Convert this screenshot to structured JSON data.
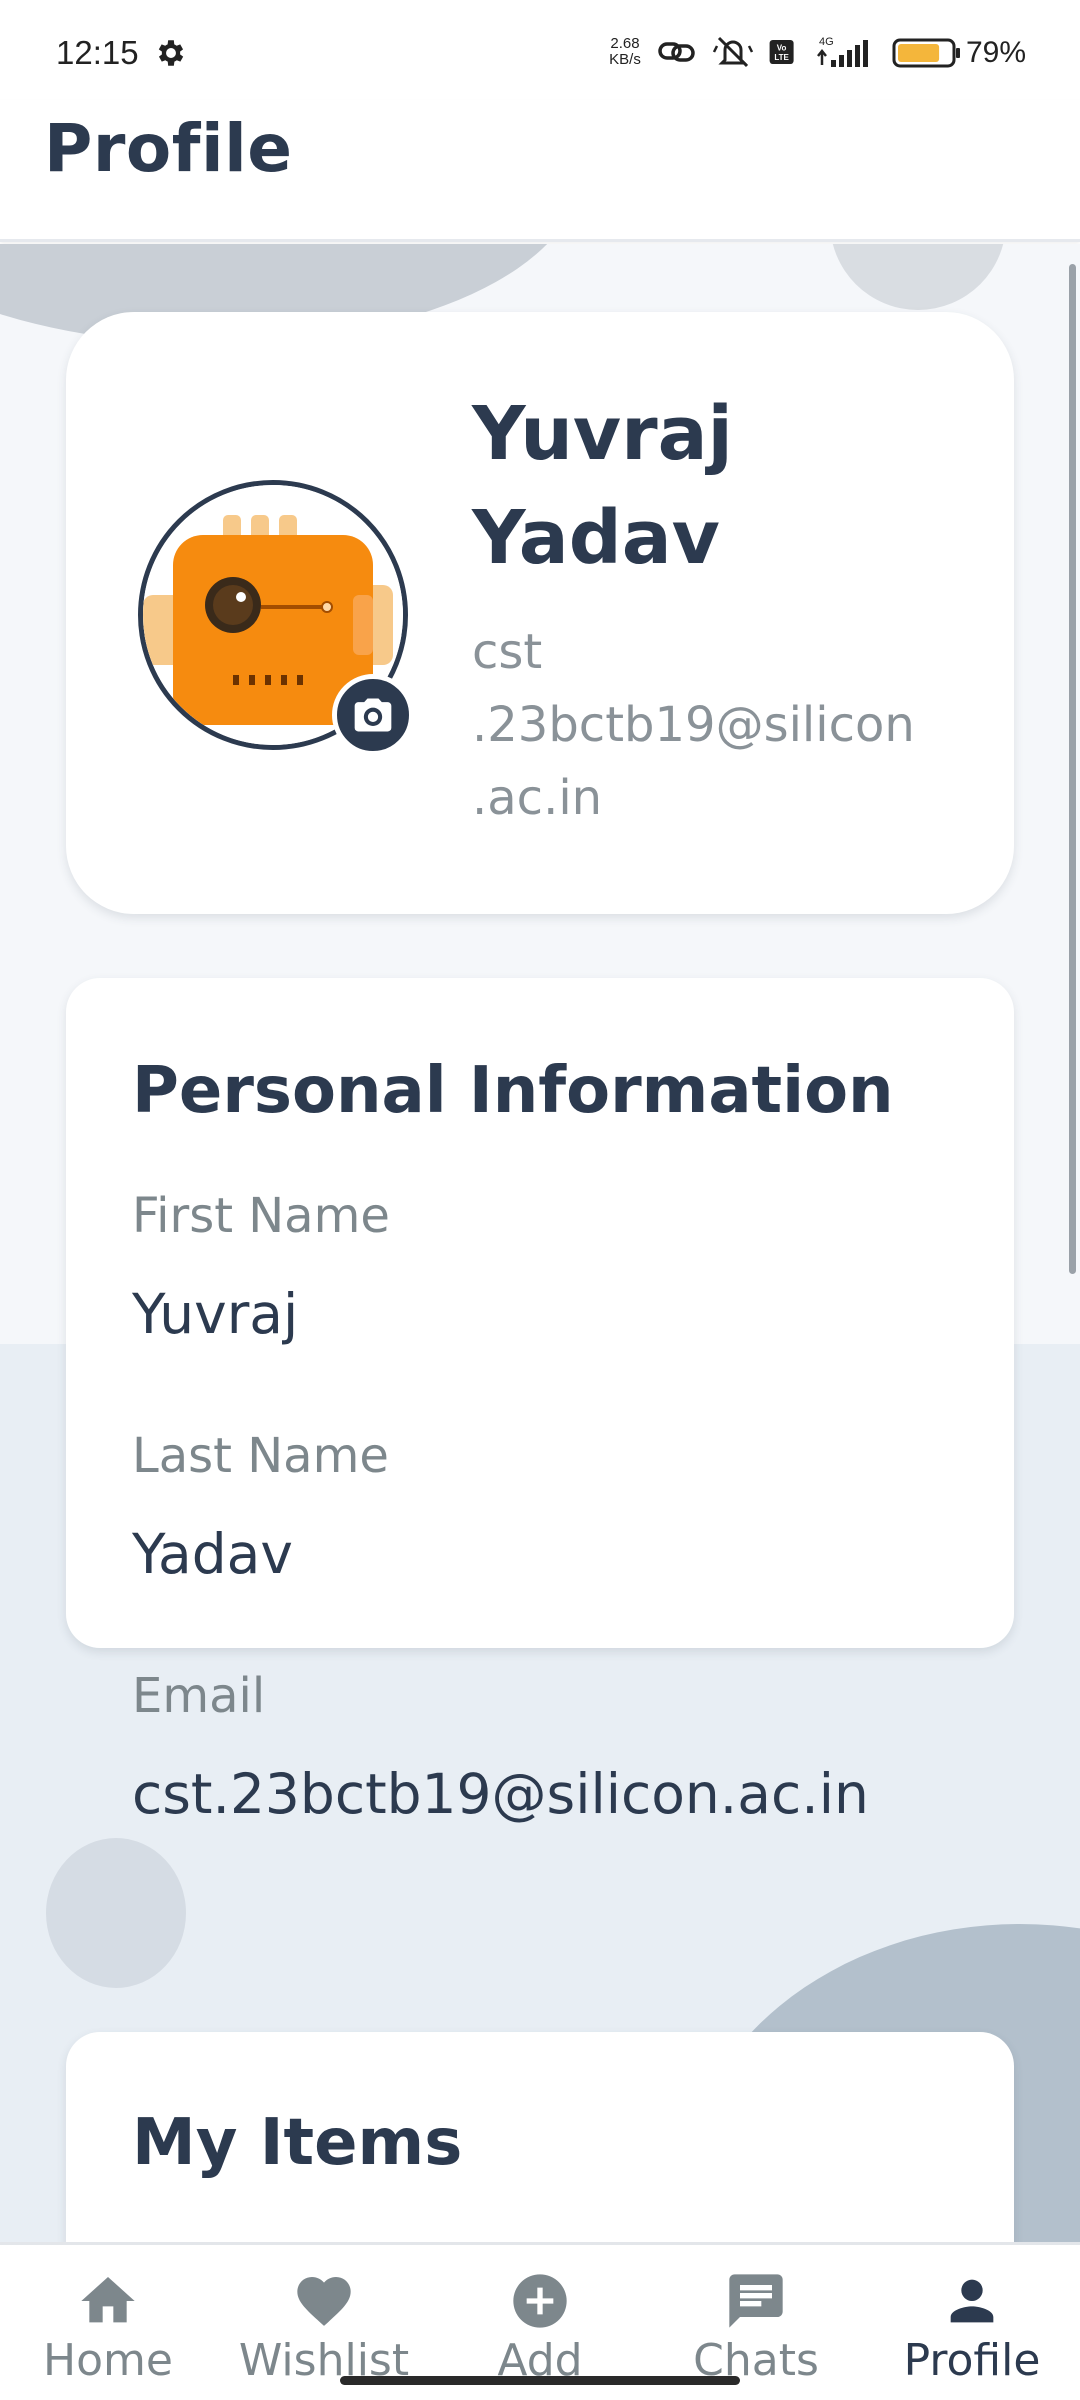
{
  "status_bar": {
    "time": "12:15",
    "network_speed_value": "2.68",
    "network_speed_unit": "KB/s",
    "icons": [
      "settings-icon",
      "link-icon",
      "mute-icon",
      "volte-icon",
      "signal-4g-icon"
    ],
    "battery_percent": "79%",
    "battery_level": 0.79
  },
  "app_bar": {
    "title": "Profile"
  },
  "profile_card": {
    "name": "Yuvraj Yadav",
    "email": "cst .23bctb19@silicon .ac.in",
    "avatar_icon": "robot-avatar-icon",
    "edit_photo_icon": "camera-icon"
  },
  "personal_info": {
    "title": "Personal Information",
    "fields": [
      {
        "label": "First Name",
        "value": "Yuvraj"
      },
      {
        "label": "Last Name",
        "value": "Yadav"
      },
      {
        "label": "Email",
        "value": "cst.23bctb19@silicon.ac.in"
      }
    ]
  },
  "my_items": {
    "title": "My Items"
  },
  "bottom_nav": {
    "items": [
      {
        "label": "Home",
        "icon": "home-icon",
        "active": false
      },
      {
        "label": "Wishlist",
        "icon": "heart-icon",
        "active": false
      },
      {
        "label": "Add",
        "icon": "add-circle-icon",
        "active": false
      },
      {
        "label": "Chats",
        "icon": "chat-icon",
        "active": false
      },
      {
        "label": "Profile",
        "icon": "person-icon",
        "active": true
      }
    ]
  },
  "colors": {
    "primary": "#2c3a4f",
    "muted": "#7d878c",
    "avatar_orange": "#f68b0f",
    "battery": "#f4b63b"
  }
}
